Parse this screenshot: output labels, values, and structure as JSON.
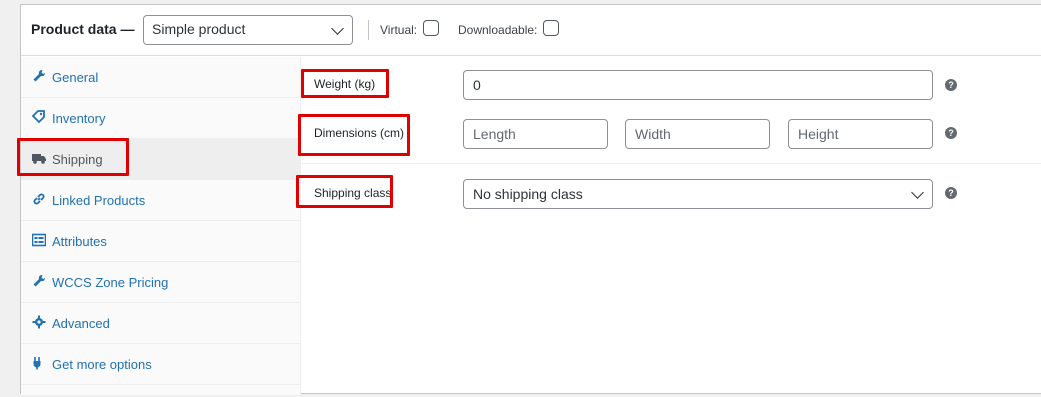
{
  "header": {
    "title": "Product data —",
    "product_type": "Simple product",
    "virtual_label": "Virtual:",
    "downloadable_label": "Downloadable:"
  },
  "sidebar": {
    "items": [
      {
        "label": "General",
        "icon": "wrench-icon",
        "active": false
      },
      {
        "label": "Inventory",
        "icon": "tag-icon",
        "active": false
      },
      {
        "label": "Shipping",
        "icon": "truck-icon",
        "active": true
      },
      {
        "label": "Linked Products",
        "icon": "link-icon",
        "active": false
      },
      {
        "label": "Attributes",
        "icon": "list-icon",
        "active": false
      },
      {
        "label": "WCCS Zone Pricing",
        "icon": "wrench-icon",
        "active": false
      },
      {
        "label": "Advanced",
        "icon": "gear-icon",
        "active": false
      },
      {
        "label": "Get more options",
        "icon": "plugin-icon",
        "active": false
      }
    ]
  },
  "shipping": {
    "weight_label": "Weight (kg)",
    "weight_value": "0",
    "dimensions_label": "Dimensions (cm)",
    "length_placeholder": "Length",
    "width_placeholder": "Width",
    "height_placeholder": "Height",
    "class_label": "Shipping class",
    "class_value": "No shipping class",
    "help_glyph": "?"
  },
  "colors": {
    "link": "#2271b1",
    "highlight": "#e00000",
    "active_tab_bg": "#eeeeee"
  }
}
